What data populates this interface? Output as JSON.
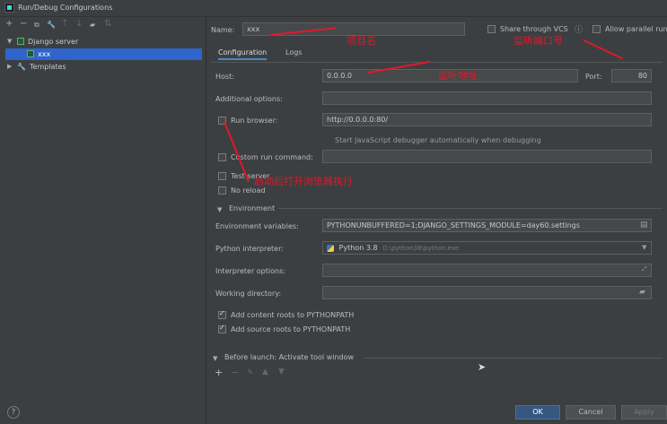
{
  "window": {
    "title": "Run/Debug Configurations"
  },
  "toolbar": {
    "add": "+",
    "remove": "−",
    "copy": "⧉",
    "edit": "🔧",
    "up": "↑",
    "down": "↓",
    "folder": "▰",
    "sort": "⇅"
  },
  "tree": {
    "group": "Django server",
    "item": "xxx",
    "templates": "Templates"
  },
  "config": {
    "name_label": "Name:",
    "name_value": "xxx",
    "share_label": "Share through VCS",
    "allow_parallel_label": "Allow parallel run",
    "tabs": [
      "Configuration",
      "Logs"
    ],
    "host_label": "Host:",
    "host_value": "0.0.0.0",
    "port_label": "Port:",
    "port_value": "80",
    "additional_label": "Additional options:",
    "run_browser_label": "Run browser:",
    "run_browser_value": "http://0.0.0.0:80/",
    "js_debugger_label": "Start JavaScript debugger automatically when debugging",
    "custom_cmd_label": "Custom run command:",
    "test_server_label": "Test server",
    "no_reload_label": "No reload",
    "environment_label": "Environment",
    "env_vars_label": "Environment variables:",
    "env_vars_value": "PYTHONUNBUFFERED=1;DJANGO_SETTINGS_MODULE=day60.settings",
    "interpreter_label": "Python interpreter:",
    "interpreter_value": "Python 3.8",
    "interpreter_path": "D:\\python38\\python.exe",
    "interp_options_label": "Interpreter options:",
    "working_dir_label": "Working directory:",
    "content_roots_label": "Add content roots to PYTHONPATH",
    "source_roots_label": "Add source roots to PYTHONPATH",
    "before_launch_label": "Before launch: Activate tool window"
  },
  "buttons": {
    "ok": "OK",
    "cancel": "Cancel",
    "apply": "Apply",
    "help": "?"
  },
  "annotations": {
    "project_name": "项目名",
    "port_note": "监听端口号",
    "host_note": "监听地址",
    "browser_note": "启动后打开浏览器执行"
  },
  "colors": {
    "accent": "#2f65ca",
    "annotation": "#e0182a"
  }
}
